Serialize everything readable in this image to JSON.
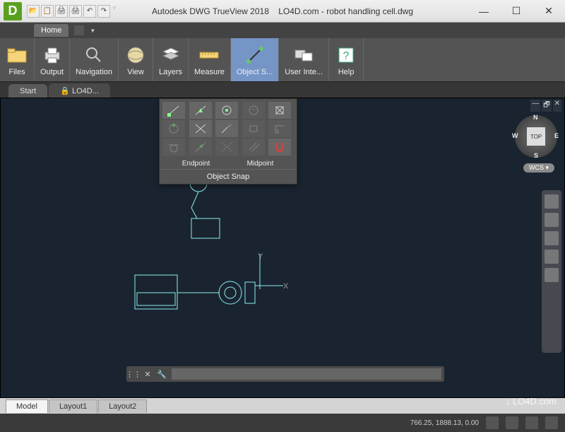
{
  "window": {
    "app_name": "Autodesk DWG TrueView 2018",
    "document": "LO4D.com - robot handling cell.dwg"
  },
  "qat_icons": [
    "open-icon",
    "copy-icon",
    "print-icon",
    "print-preview-icon",
    "undo-icon",
    "redo-icon"
  ],
  "ribbon": {
    "tab": "Home",
    "panels": [
      {
        "id": "files",
        "label": "Files",
        "icon": "folder-icon"
      },
      {
        "id": "output",
        "label": "Output",
        "icon": "printer-icon"
      },
      {
        "id": "navigation",
        "label": "Navigation",
        "icon": "magnifier-icon"
      },
      {
        "id": "view",
        "label": "View",
        "icon": "globe-icon"
      },
      {
        "id": "layers",
        "label": "Layers",
        "icon": "layers-icon"
      },
      {
        "id": "measure",
        "label": "Measure",
        "icon": "ruler-icon"
      },
      {
        "id": "object-snap",
        "label": "Object S...",
        "icon": "snap-icon",
        "selected": true
      },
      {
        "id": "user-interface",
        "label": "User Inte...",
        "icon": "screens-icon"
      },
      {
        "id": "help",
        "label": "Help",
        "icon": "help-icon"
      }
    ]
  },
  "doc_tabs": [
    "Start",
    "LO4D..."
  ],
  "object_snap": {
    "title": "Object Snap",
    "row_labels": [
      "Endpoint",
      "Midpoint"
    ],
    "items": [
      {
        "name": "endpoint-icon",
        "on": true
      },
      {
        "name": "midpoint-icon",
        "on": true
      },
      {
        "name": "center-icon",
        "on": true
      },
      {
        "name": "geometric-center-icon",
        "on": false
      },
      {
        "name": "node-icon",
        "on": true
      },
      {
        "name": "quadrant-icon",
        "on": false
      },
      {
        "name": "intersection-icon",
        "on": true
      },
      {
        "name": "extension-icon",
        "on": true
      },
      {
        "name": "insertion-icon",
        "on": false
      },
      {
        "name": "perpendicular-icon",
        "on": false
      },
      {
        "name": "tangent-icon",
        "on": false
      },
      {
        "name": "nearest-icon",
        "on": false
      },
      {
        "name": "apparent-intersection-icon",
        "on": false
      },
      {
        "name": "parallel-icon",
        "on": false
      },
      {
        "name": "magnet-icon",
        "on": true
      }
    ]
  },
  "viewcube": {
    "face": "TOP",
    "dirs": {
      "n": "N",
      "s": "S",
      "e": "E",
      "w": "W"
    }
  },
  "wcs": "WCS",
  "axes": {
    "x": "X",
    "y": "Y"
  },
  "layout_tabs": [
    "Model",
    "Layout1",
    "Layout2"
  ],
  "status": {
    "coords": "766.25, 1888.13, 0.00"
  },
  "command_line": {
    "placeholder": ""
  },
  "watermark": "↓ LO4D.com"
}
